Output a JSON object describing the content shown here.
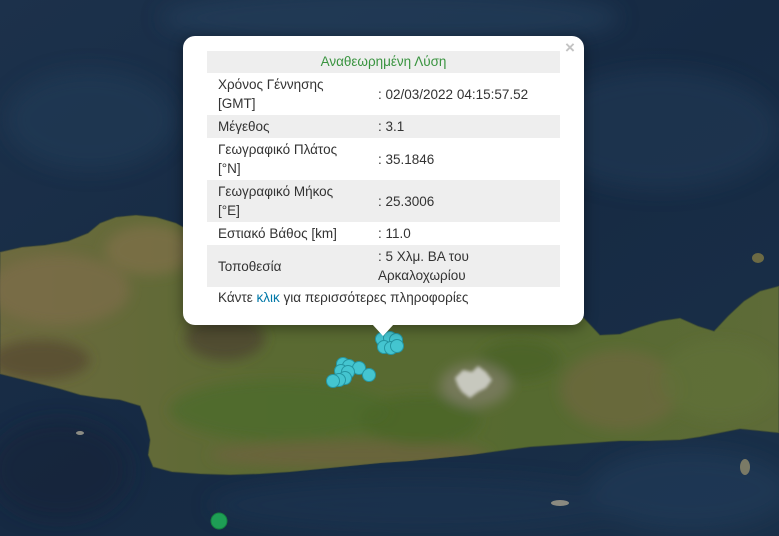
{
  "popup": {
    "close_symbol": "×",
    "title": "Αναθεωρημένη Λύση",
    "rows": [
      {
        "label": "Χρόνος Γέννησης [GMT]",
        "value": ": 02/03/2022 04:15:57.52"
      },
      {
        "label": "Μέγεθος",
        "value": ": 3.1"
      },
      {
        "label": "Γεωγραφικό Πλάτος [°N]",
        "value": ": 35.1846"
      },
      {
        "label": "Γεωγραφικό Μήκος [°E]",
        "value": ": 25.3006"
      },
      {
        "label": "Εστιακό Βάθος [km]",
        "value": ": 11.0"
      },
      {
        "label": "Τοποθεσία",
        "value": ": 5 Χλμ. ΒΑ του Αρκαλοχωρίου"
      }
    ],
    "footer": {
      "prefix": "Κάντε",
      "link": "κλικ",
      "suffix": "για περισσότερες πληροφορίες"
    }
  },
  "icons": {
    "close": "close-icon",
    "event_marker": "circle-marker-icon"
  },
  "colors": {
    "title_green": "#3a9440",
    "link_blue": "#0078a8",
    "row_stripe": "#eeeeee",
    "marker_cyan": "#44c5d0",
    "marker_green": "#1e9e55"
  }
}
